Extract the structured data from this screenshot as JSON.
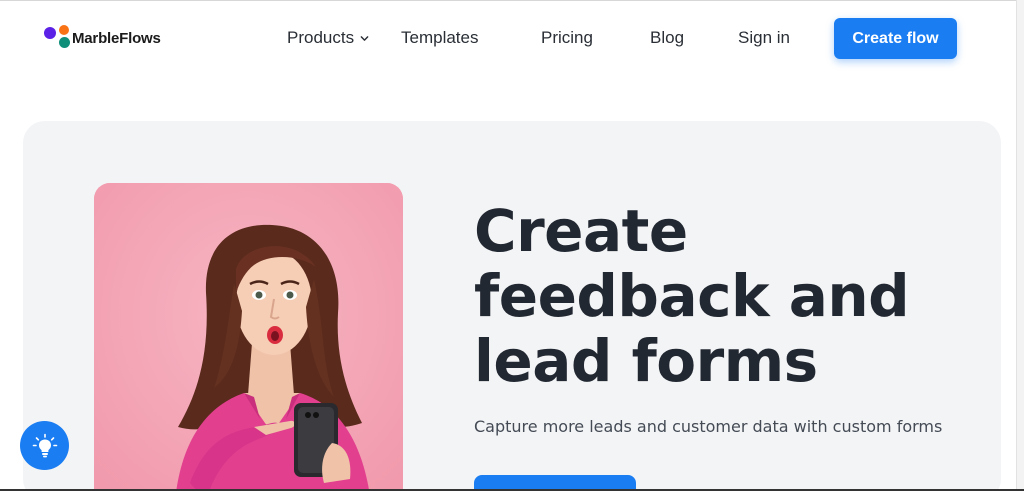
{
  "brand": {
    "name": "MarbleFlows",
    "colors": {
      "primary": "#1a7df2",
      "purple": "#5b21e6",
      "orange": "#f97316",
      "teal": "#0f8f7a"
    }
  },
  "nav": {
    "items": [
      {
        "label": "Products",
        "has_dropdown": true,
        "icon": "chevron-down-icon"
      },
      {
        "label": "Templates"
      },
      {
        "label": "Pricing"
      },
      {
        "label": "Blog"
      },
      {
        "label": "Sign in"
      }
    ],
    "cta_label": "Create flow"
  },
  "hero": {
    "headline_lines": [
      "Create",
      "feedback and",
      "lead forms"
    ],
    "subheadline": "Capture more leads and customer data with custom forms",
    "photo_icon": "woman-pointing-at-phone-photo",
    "background_color": "#f3f4f6",
    "photo_background": "#f5a6b6"
  },
  "help_widget": {
    "icon": "lightbulb-icon"
  }
}
